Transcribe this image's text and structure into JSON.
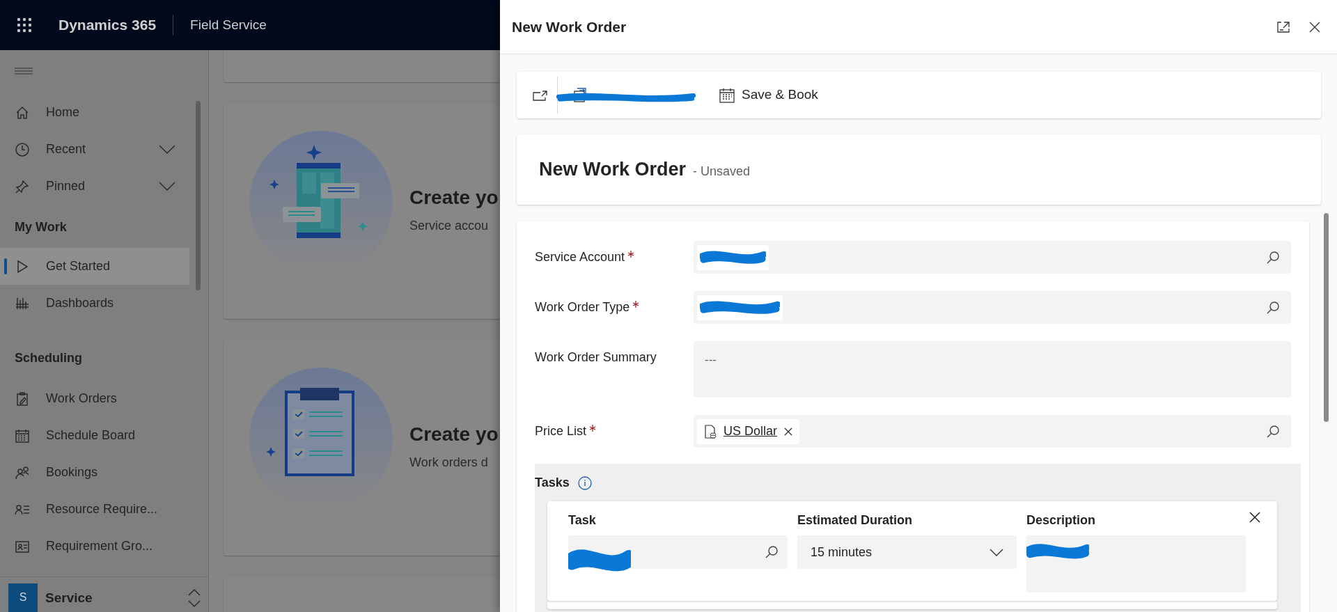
{
  "app_bar": {
    "title": "Dynamics 365",
    "app_name": "Field Service"
  },
  "sidebar": {
    "top_items": [
      {
        "label": "Home",
        "kind": "link",
        "selected": false
      },
      {
        "label": "Recent",
        "kind": "flyout",
        "expanded": false,
        "selected": false
      },
      {
        "label": "Pinned",
        "kind": "flyout",
        "expanded": false,
        "selected": false
      }
    ],
    "groups": [
      {
        "title": "My Work",
        "items": [
          {
            "label": "Get Started",
            "selected": true
          },
          {
            "label": "Dashboards",
            "selected": false
          }
        ]
      },
      {
        "title": "Scheduling",
        "items": [
          {
            "label": "Work Orders",
            "selected": false
          },
          {
            "label": "Schedule Board",
            "selected": false
          },
          {
            "label": "Bookings",
            "selected": false
          },
          {
            "label": "Resource Require...",
            "selected": false
          },
          {
            "label": "Requirement Gro...",
            "selected": false
          }
        ]
      }
    ],
    "area_switcher": {
      "initial": "S",
      "label": "Service"
    }
  },
  "cards": [
    {
      "title": "Create yo",
      "text": "Service accou"
    },
    {
      "title": "Create yo",
      "text": "Work orders d"
    }
  ],
  "panel": {
    "title": "New Work Order",
    "toolbar": [
      {
        "kind": "popout"
      },
      {
        "kind": "scribbled"
      },
      {
        "kind": "button",
        "label": "Save & Book"
      }
    ],
    "header": {
      "title": "New Work Order",
      "status": "- Unsaved"
    },
    "fields": [
      {
        "label": "Service Account",
        "required": true,
        "kind": "lookup"
      },
      {
        "label": "Work Order Type",
        "required": true,
        "kind": "lookup"
      },
      {
        "label": "Work Order Summary",
        "required": false,
        "kind": "textarea",
        "value": "---"
      },
      {
        "label": "Price List",
        "required": true,
        "kind": "lookup",
        "value": "US Dollar"
      }
    ],
    "tasks": {
      "title": "Tasks",
      "columns": [
        "Task",
        "Estimated Duration",
        "Description"
      ],
      "rows": [
        {
          "estimated_duration": "15 minutes"
        }
      ]
    }
  }
}
